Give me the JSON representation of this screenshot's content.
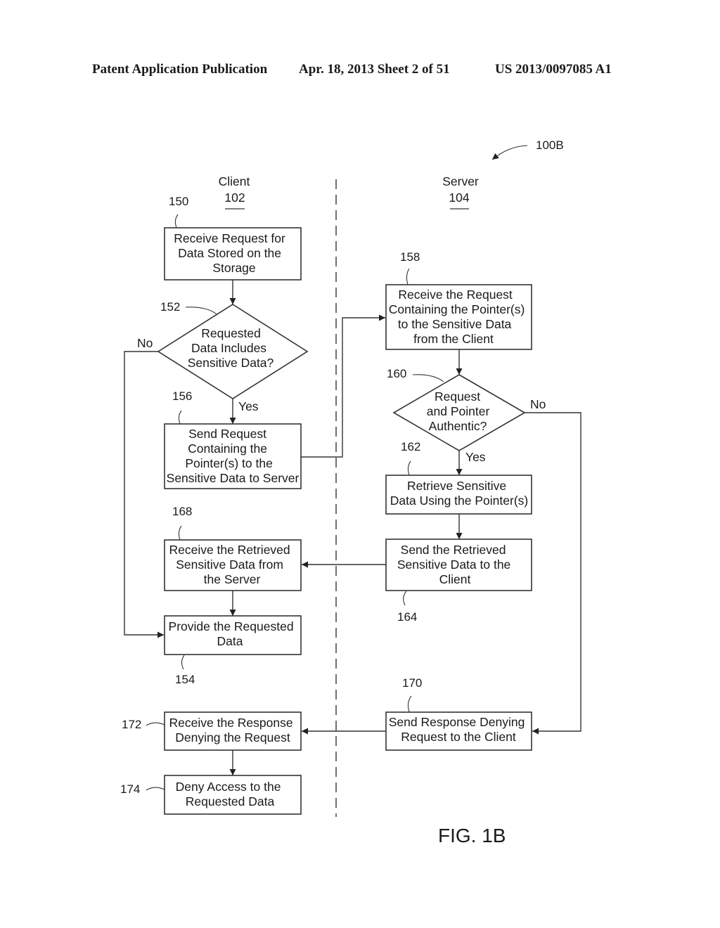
{
  "header": {
    "publication": "Patent Application Publication",
    "date_sheet": "Apr. 18, 2013  Sheet 2 of 51",
    "number": "US 2013/0097085 A1"
  },
  "figure": {
    "ref": "100B",
    "caption": "FIG. 1B"
  },
  "lanes": {
    "client": {
      "title": "Client",
      "ref": "102"
    },
    "server": {
      "title": "Server",
      "ref": "104"
    }
  },
  "steps": {
    "s150": {
      "ref": "150",
      "lines": [
        "Receive Request for",
        "Data Stored on the",
        "Storage"
      ]
    },
    "s152": {
      "ref": "152",
      "lines": [
        "Requested",
        "Data Includes",
        "Sensitive Data?"
      ]
    },
    "s156": {
      "ref": "156",
      "lines": [
        "Send Request",
        "Containing the",
        "Pointer(s) to the",
        "Sensitive Data to Server"
      ]
    },
    "s158": {
      "ref": "158",
      "lines": [
        "Receive the Request",
        "Containing the Pointer(s)",
        "to the Sensitive Data",
        "from the Client"
      ]
    },
    "s160": {
      "ref": "160",
      "lines": [
        "Request",
        "and Pointer",
        "Authentic?"
      ]
    },
    "s162": {
      "ref": "162",
      "lines": [
        "Retrieve Sensitive",
        "Data Using the Pointer(s)"
      ]
    },
    "s164": {
      "ref": "164",
      "lines": [
        "Send the Retrieved",
        "Sensitive Data to the",
        "Client"
      ]
    },
    "s168": {
      "ref": "168",
      "lines": [
        "Receive the Retrieved",
        "Sensitive Data from",
        "the Server"
      ]
    },
    "s154": {
      "ref": "154",
      "lines": [
        "Provide the Requested",
        "Data"
      ]
    },
    "s170": {
      "ref": "170",
      "lines": [
        "Send Response Denying",
        "Request to the Client"
      ]
    },
    "s172": {
      "ref": "172",
      "lines": [
        "Receive the Response",
        "Denying the Request"
      ]
    },
    "s174": {
      "ref": "174",
      "lines": [
        "Deny Access to the",
        "Requested Data"
      ]
    }
  },
  "branch_labels": {
    "yes": "Yes",
    "no": "No"
  }
}
